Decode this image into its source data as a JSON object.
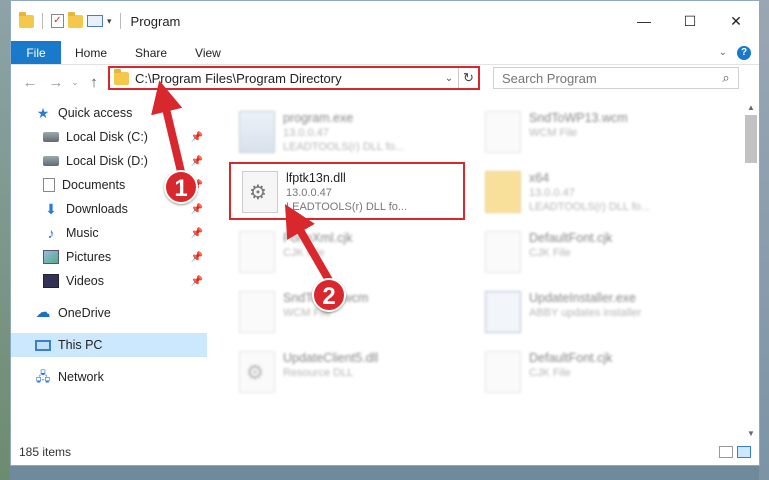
{
  "window": {
    "title": "Program",
    "controls": {
      "minimize": "—",
      "maximize": "☐",
      "close": "✕"
    }
  },
  "ribbon": {
    "tabs": [
      "File",
      "Home",
      "Share",
      "View"
    ],
    "help": "?"
  },
  "address": {
    "path": "C:\\Program Files\\Program Directory",
    "search_placeholder": "Search Program"
  },
  "sidebar": {
    "items": [
      {
        "label": "Quick access",
        "icon": "star-icon",
        "pinned": false
      },
      {
        "label": "Local Disk (C:)",
        "icon": "disk-icon",
        "pinned": true
      },
      {
        "label": "Local Disk (D:)",
        "icon": "disk-icon",
        "pinned": true
      },
      {
        "label": "Documents",
        "icon": "documents-icon",
        "pinned": true
      },
      {
        "label": "Downloads",
        "icon": "download-icon",
        "pinned": true
      },
      {
        "label": "Music",
        "icon": "music-icon",
        "pinned": true
      },
      {
        "label": "Pictures",
        "icon": "pictures-icon",
        "pinned": true
      },
      {
        "label": "Videos",
        "icon": "videos-icon",
        "pinned": true
      },
      {
        "label": "OneDrive",
        "icon": "onedrive-icon",
        "pinned": false
      },
      {
        "label": "This PC",
        "icon": "computer-icon",
        "pinned": false,
        "selected": true
      },
      {
        "label": "Network",
        "icon": "network-icon",
        "pinned": false
      }
    ]
  },
  "files": [
    {
      "name": "program.exe",
      "line2": "13.0.0.47",
      "line3": "LEADTOOLS(r) DLL fo...",
      "icon": "exe-icon"
    },
    {
      "name": "SndToWP13.wcm",
      "line2": "WCM File",
      "line3": "",
      "icon": "file-icon"
    },
    {
      "name": "lfptk13n.dll",
      "line2": "13.0.0.47",
      "line3": "LEADTOOLS(r) DLL fo...",
      "icon": "gear-file-icon"
    },
    {
      "name": "x64",
      "line2": "13.0.0.47",
      "line3": "LEADTOOLS(r) DLL fo...",
      "icon": "folder-icon"
    },
    {
      "name": "FormXml.cjk",
      "line2": "CJK File",
      "line3": "",
      "icon": "file-icon"
    },
    {
      "name": "DefaultFont.cjk",
      "line2": "CJK File",
      "line3": "",
      "icon": "file-icon"
    },
    {
      "name": "SndToFax.wcm",
      "line2": "WCM File",
      "line3": "",
      "icon": "file-icon"
    },
    {
      "name": "UpdateInstaller.exe",
      "line2": "ABBY updates installer",
      "line3": "",
      "icon": "installer-icon"
    },
    {
      "name": "UpdateClient5.dll",
      "line2": "Resource DLL",
      "line3": "",
      "icon": "gear-file-icon"
    },
    {
      "name": "DefaultFont.cjk",
      "line2": "CJK File",
      "line3": "",
      "icon": "file-icon"
    }
  ],
  "status": {
    "items": "185 items"
  },
  "annotations": {
    "step1": "1",
    "step2": "2",
    "color": "#d9272e"
  }
}
